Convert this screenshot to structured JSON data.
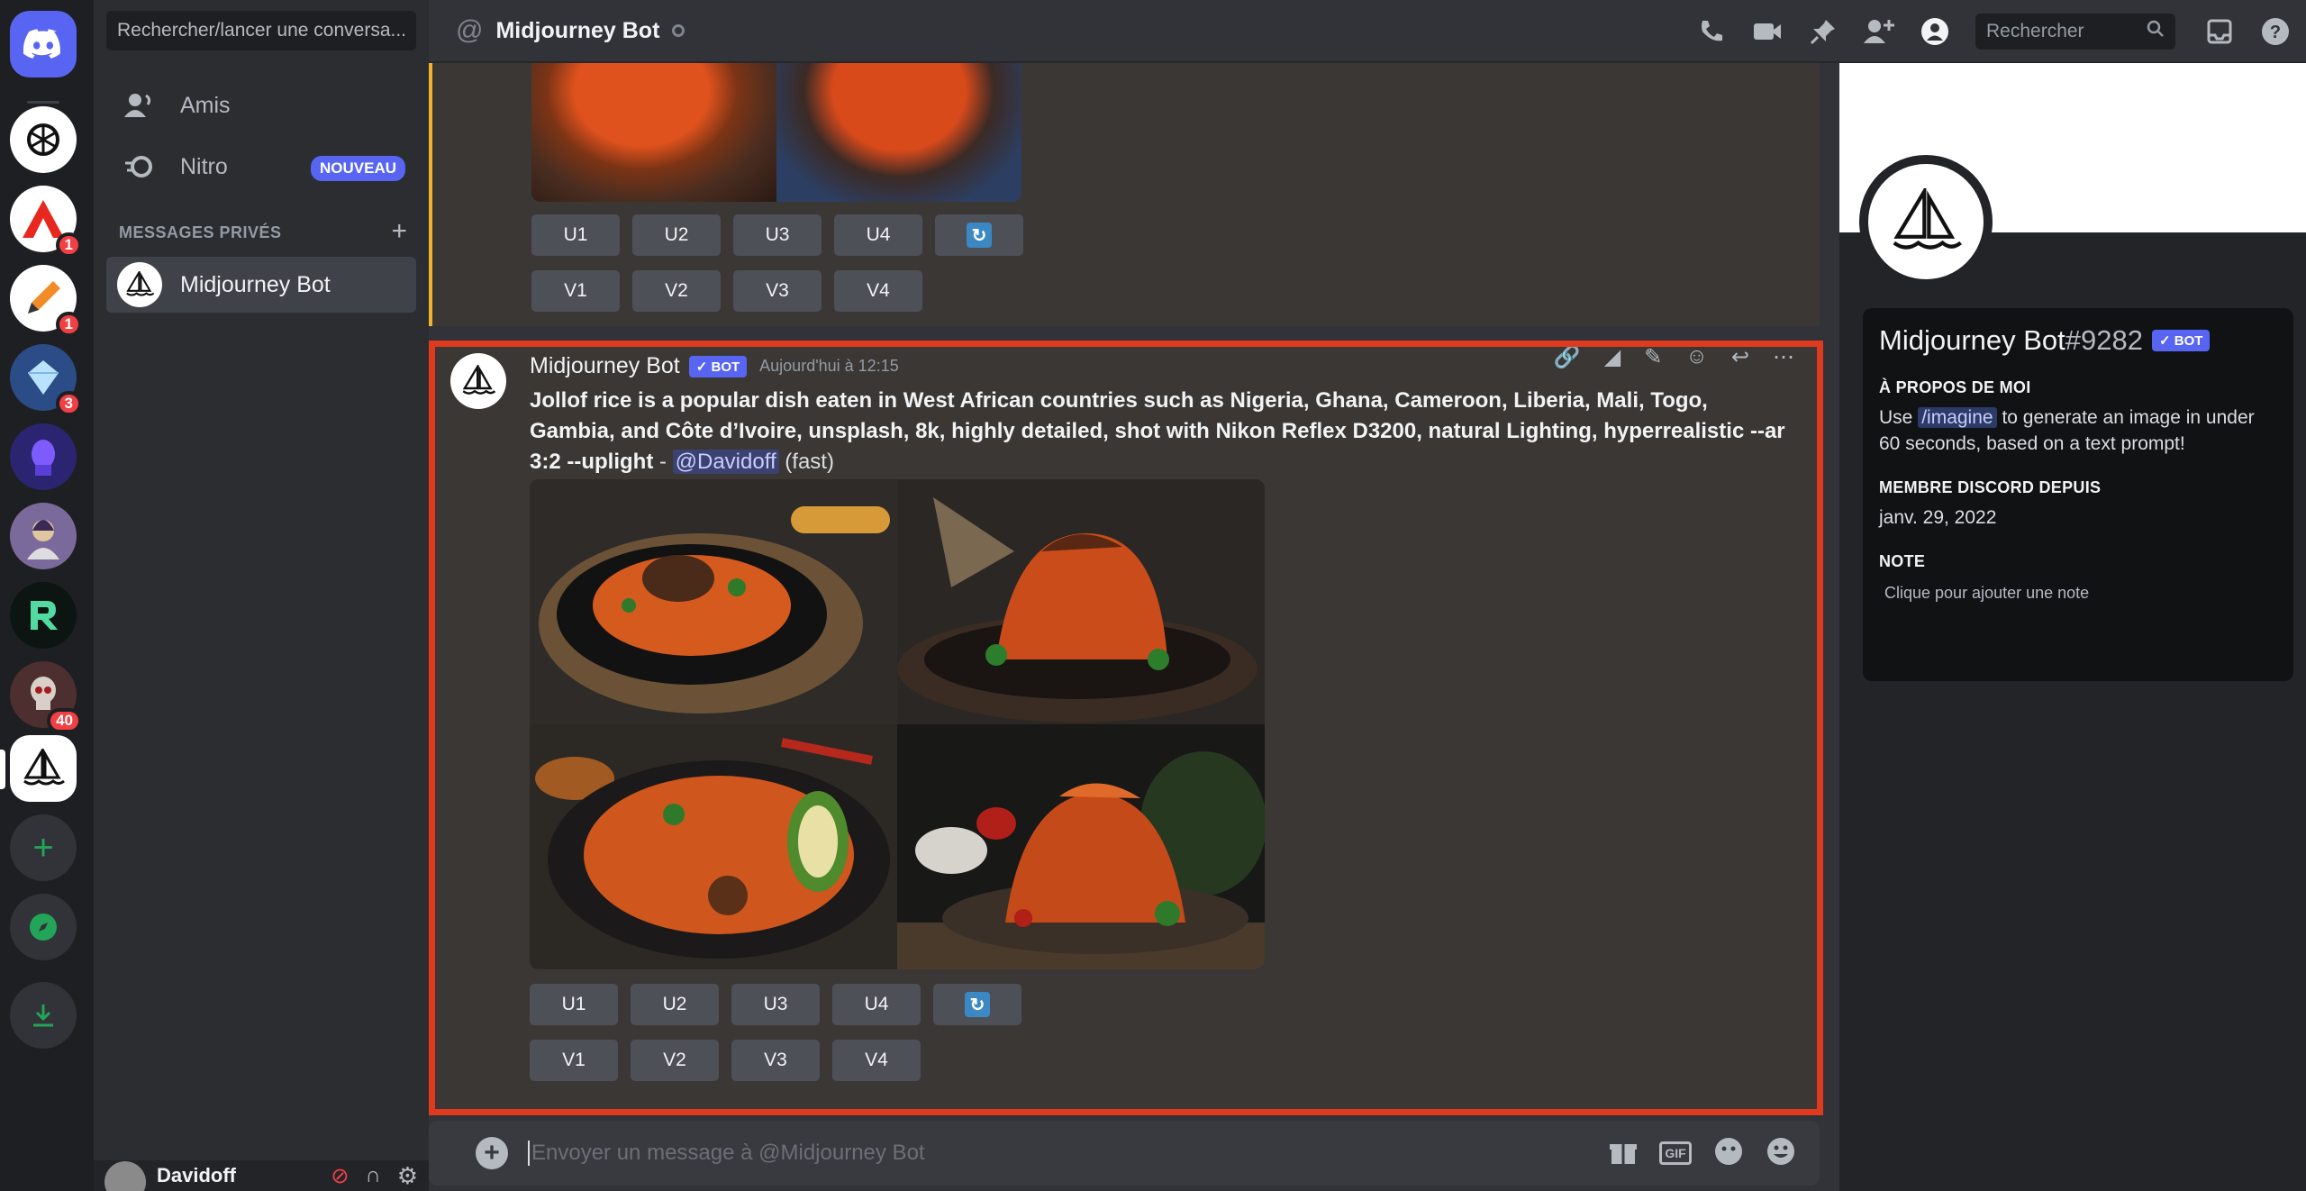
{
  "dm_sidebar": {
    "search_placeholder": "Rechercher/lancer une conversa...",
    "friends_label": "Amis",
    "nitro_label": "Nitro",
    "nitro_badge": "NOUVEAU",
    "section_title": "MESSAGES PRIVÉS",
    "dm_name": "Midjourney Bot",
    "user_name": "Davidoff"
  },
  "servers": {
    "badges": [
      "1",
      "1",
      "3",
      "40"
    ]
  },
  "header": {
    "title": "Midjourney Bot",
    "search_placeholder": "Rechercher"
  },
  "previous_message": {
    "upscale_buttons": [
      "U1",
      "U2",
      "U3",
      "U4"
    ],
    "variation_buttons": [
      "V1",
      "V2",
      "V3",
      "V4"
    ]
  },
  "message": {
    "author": "Midjourney Bot",
    "bot_badge": "✓ BOT",
    "timestamp": "Aujourd'hui à 12:15",
    "prompt": "Jollof rice is a popular dish eaten in West African countries such as Nigeria, Ghana, Cameroon, Liberia, Mali, Togo, Gambia, and Côte d’Ivoire, unsplash, 8k, highly detailed, shot with Nikon Reflex D3200, natural Lighting, hyperrealistic --ar 3:2 --uplight",
    "separator": " - ",
    "mention": "@Davidoff",
    "suffix": " (fast)",
    "upscale_buttons": [
      "U1",
      "U2",
      "U3",
      "U4"
    ],
    "variation_buttons": [
      "V1",
      "V2",
      "V3",
      "V4"
    ]
  },
  "composer": {
    "placeholder": "Envoyer un message à @Midjourney Bot",
    "gif_label": "GIF"
  },
  "profile": {
    "name": "Midjourney Bot",
    "tag": "#9282",
    "bot_badge": "✓ BOT",
    "about_title": "À PROPOS DE MOI",
    "about_pre": "Use",
    "about_cmd": "/imagine",
    "about_post": "to generate an image in under 60 seconds, based on a text prompt!",
    "member_title": "MEMBRE DISCORD DEPUIS",
    "member_since": "janv. 29, 2022",
    "note_title": "NOTE",
    "note_placeholder": "Clique pour ajouter une note"
  },
  "colors": {
    "accent": "#5865f2",
    "highlight_frame": "#e03a1e",
    "badge_red": "#f23f43"
  }
}
